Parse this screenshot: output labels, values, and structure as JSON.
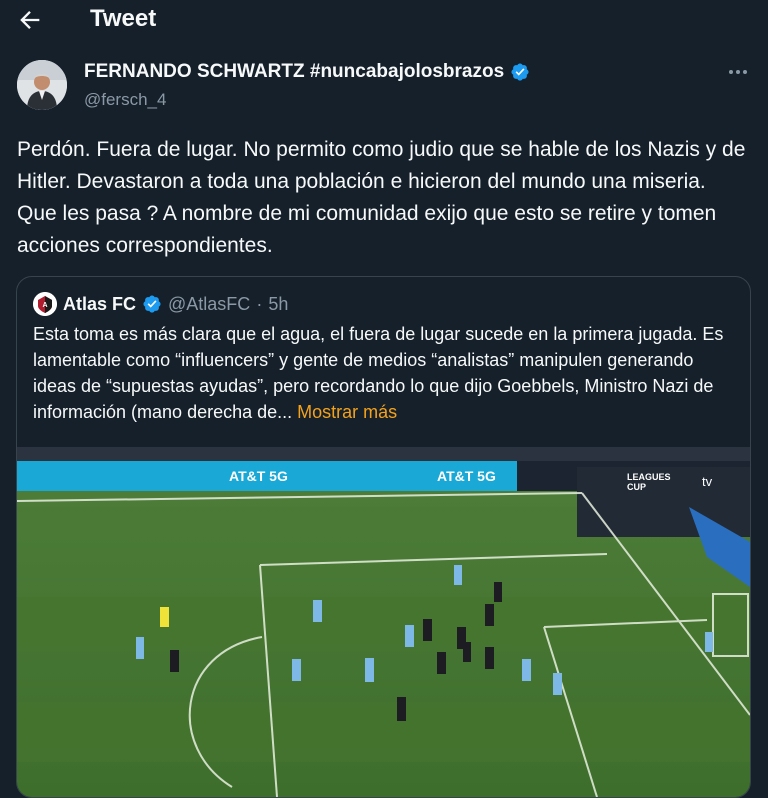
{
  "header": {
    "title": "Tweet"
  },
  "author": {
    "display_name": "FERNANDO SCHWARTZ #nuncabajolosbrazos",
    "handle": "@fersch_4"
  },
  "tweet": {
    "text": "Perdón. Fuera de lugar. No permito como judio que se hable de los Nazis y de Hitler. Devastaron a toda una población e hicieron del mundo una miseria. Que les pasa ?  A nombre de mi comunidad exijo que esto se retire y tomen acciones correspondientes."
  },
  "quoted": {
    "name": "Atlas FC",
    "handle": "@AtlasFC",
    "separator": "·",
    "time": "5h",
    "text": "Esta toma es más clara que el agua, el fuera de lugar sucede en la primera jugada. Es lamentable como “influencers” y gente de medios “analistas” manipulen generando ideas de “supuestas ayudas”, pero recordando lo que dijo Goebbels, Ministro Nazi de información (mano derecha de...",
    "show_more": "Mostrar más",
    "media": {
      "ad_board_text": "AT&T 5G",
      "broadcast_logo_line1": "LEAGUES",
      "broadcast_logo_line2": "CUP",
      "broadcaster": "tv"
    }
  },
  "colors": {
    "background": "#15202b",
    "text_primary": "#f7f9f9",
    "text_secondary": "#8b98a5",
    "verified": "#1d9bf0",
    "show_more": "#f4a21b",
    "border": "#38444d"
  },
  "icons": [
    "back-arrow-icon",
    "verified-badge-icon",
    "more-options-icon"
  ]
}
